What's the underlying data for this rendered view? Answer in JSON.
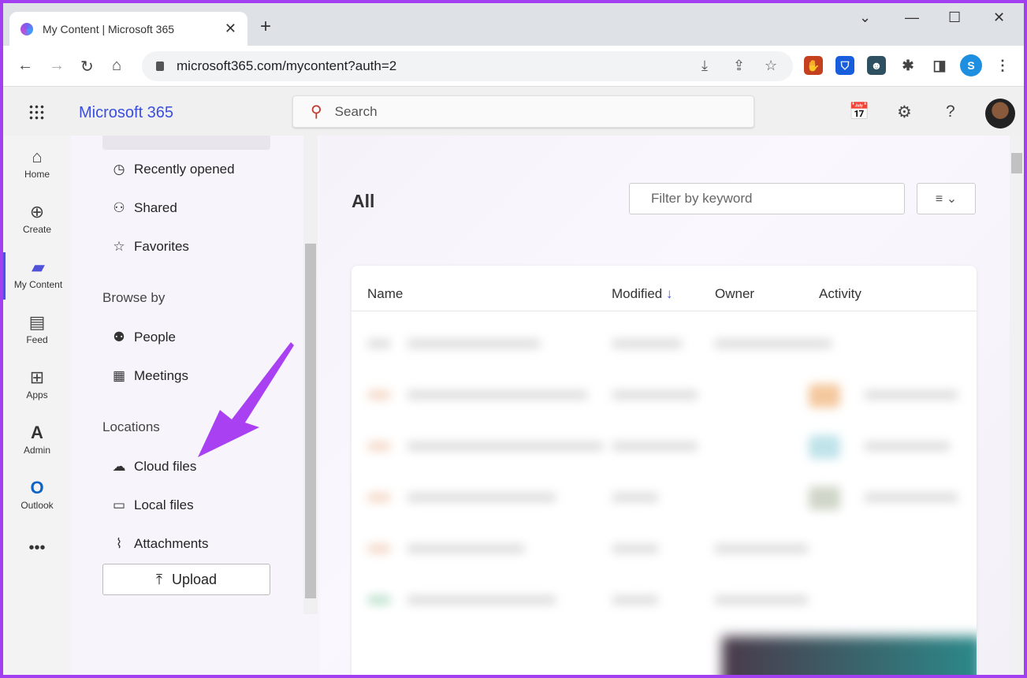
{
  "browser": {
    "tab_title": "My Content | Microsoft 365",
    "url": "microsoft365.com/mycontent?auth=2"
  },
  "app": {
    "brand": "Microsoft 365",
    "search_placeholder": "Search"
  },
  "rail": [
    {
      "label": "Home",
      "icon": "⌂"
    },
    {
      "label": "Create",
      "icon": "⊕"
    },
    {
      "label": "My Content",
      "icon": "▰"
    },
    {
      "label": "Feed",
      "icon": "▤"
    },
    {
      "label": "Apps",
      "icon": "⊞"
    },
    {
      "label": "Admin",
      "icon": "A"
    },
    {
      "label": "Outlook",
      "icon": "O"
    }
  ],
  "pane": {
    "items": [
      "Recently opened",
      "Shared",
      "Favorites"
    ],
    "browse_by": "Browse by",
    "browse_items": [
      "People",
      "Meetings"
    ],
    "locations": "Locations",
    "location_items": [
      "Cloud files",
      "Local files",
      "Attachments"
    ],
    "upload": "Upload"
  },
  "main": {
    "title": "All",
    "filter_placeholder": "Filter by keyword",
    "columns": [
      "Name",
      "Modified",
      "Owner",
      "Activity"
    ]
  },
  "accent": "#a23ff0"
}
